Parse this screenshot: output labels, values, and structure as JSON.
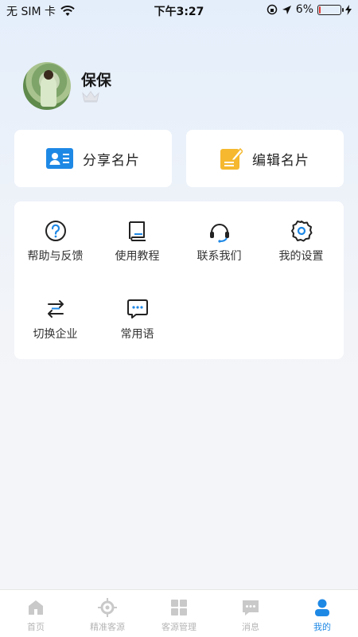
{
  "status_bar": {
    "carrier": "无 SIM 卡",
    "time": "下午3:27",
    "battery_percent": "6%",
    "battery_level": 0.06
  },
  "profile": {
    "name": "保保"
  },
  "actions": {
    "share_label": "分享名片",
    "edit_label": "编辑名片"
  },
  "menu": [
    {
      "label": "帮助与反馈",
      "icon": "help-circle-icon"
    },
    {
      "label": "使用教程",
      "icon": "book-icon"
    },
    {
      "label": "联系我们",
      "icon": "headset-icon"
    },
    {
      "label": "我的设置",
      "icon": "gear-icon"
    },
    {
      "label": "切换企业",
      "icon": "switch-icon"
    },
    {
      "label": "常用语",
      "icon": "chat-bubble-icon"
    }
  ],
  "tabs": [
    {
      "label": "首页",
      "icon": "home-icon",
      "active": false
    },
    {
      "label": "精准客源",
      "icon": "target-icon",
      "active": false
    },
    {
      "label": "客源管理",
      "icon": "grid-icon",
      "active": false
    },
    {
      "label": "消息",
      "icon": "message-icon",
      "active": false
    },
    {
      "label": "我的",
      "icon": "user-icon",
      "active": true
    }
  ],
  "colors": {
    "accent": "#1e88e5",
    "share_icon": "#1e88e5",
    "edit_icon": "#f5b82e",
    "tab_inactive": "#b5b5b5"
  }
}
